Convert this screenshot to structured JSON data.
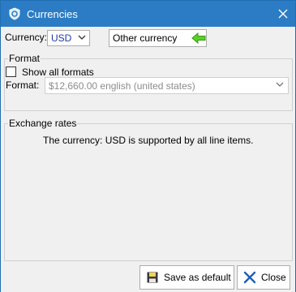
{
  "window": {
    "title": "Currencies",
    "accent_color": "#2b7cc4",
    "title_icon": "currency-shield-icon"
  },
  "currency": {
    "label": "Currency:",
    "selected": "USD",
    "other_button_label": "Other currency",
    "other_button_icon": "green-left-arrow-icon"
  },
  "format_group": {
    "title": "Format",
    "show_all_label": "Show all formats",
    "show_all_checked": false,
    "format_label": "Format:",
    "format_value": "$12,660.00 english (united states)"
  },
  "exchange_group": {
    "title": "Exchange rates",
    "message": "The currency: USD is supported by all line items."
  },
  "footer": {
    "save_label": "Save as default",
    "close_label": "Close"
  }
}
